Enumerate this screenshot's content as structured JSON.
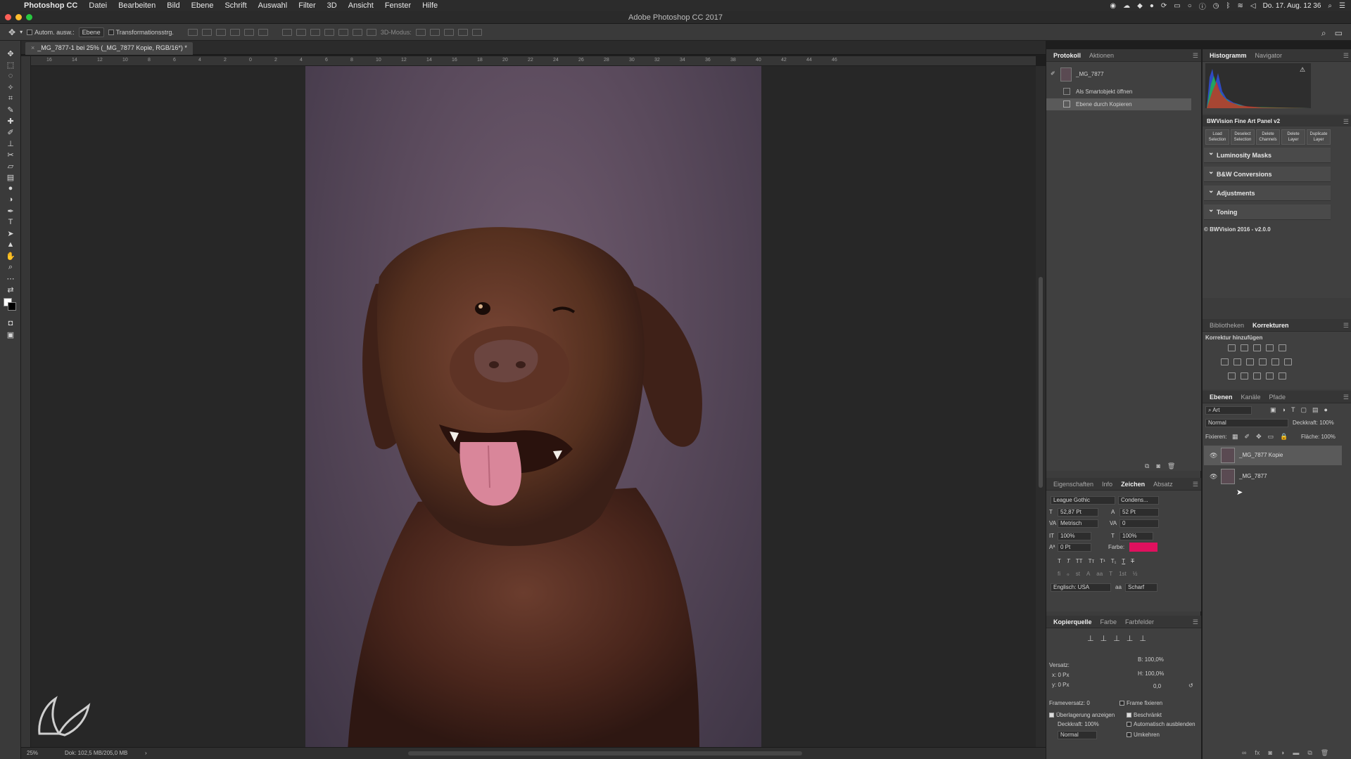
{
  "menubar": {
    "app": "Photoshop CC",
    "items": [
      "Datei",
      "Bearbeiten",
      "Bild",
      "Ebene",
      "Schrift",
      "Auswahl",
      "Filter",
      "3D",
      "Ansicht",
      "Fenster",
      "Hilfe"
    ],
    "clock": "Do. 17. Aug.  12 36"
  },
  "window": {
    "title": "Adobe Photoshop CC 2017"
  },
  "options": {
    "auto_select": "Autom. ausw.:",
    "target": "Ebene",
    "transform": "Transformationsstrg.",
    "mode3d": "3D-Modus:"
  },
  "document": {
    "tab": "_MG_7877-1 bei 25% (_MG_7877 Kopie, RGB/16*) *",
    "ruler_labels": [
      "16",
      "14",
      "12",
      "10",
      "8",
      "6",
      "4",
      "2",
      "0",
      "2",
      "4",
      "6",
      "8",
      "10",
      "12",
      "14",
      "16",
      "18",
      "20",
      "22",
      "24",
      "26",
      "28",
      "30",
      "32",
      "34",
      "36",
      "38",
      "40",
      "42",
      "44",
      "46"
    ],
    "zoom": "25%",
    "doc_size": "Dok: 102,5 MB/205,0 MB"
  },
  "history": {
    "tabs": [
      "Protokoll",
      "Aktionen"
    ],
    "snapshot": "_MG_7877",
    "steps": [
      "Als Smartobjekt öffnen",
      "Ebene durch Kopieren"
    ]
  },
  "character": {
    "tabs": [
      "Eigenschaften",
      "Info",
      "Zeichen",
      "Absatz"
    ],
    "font": "League Gothic",
    "style": "Condens...",
    "size": "52,87 Pt",
    "leading": "52 Pt",
    "kerning": "Metrisch",
    "tracking": "0",
    "vscale": "100%",
    "hscale": "100%",
    "baseline": "0 Pt",
    "color_label": "Farbe:",
    "color": "#e0105e",
    "language": "Englisch: USA",
    "antialias": "Scharf"
  },
  "clone_source": {
    "tabs": [
      "Kopierquelle",
      "Farbe",
      "Farbfelder"
    ],
    "offset_label": "Versatz:",
    "x": "x: 0 Px",
    "y": "y: 0 Px",
    "w": "B: 100,0%",
    "h": "H: 100,0%",
    "angle": "0,0",
    "frame_offset_label": "Frameversatz: 0",
    "lock_frame": "Frame fixieren",
    "show_overlay": "Überlagerung anzeigen",
    "clipped": "Beschränkt",
    "opacity": "Deckkraft: 100%",
    "auto_hide": "Automatisch ausblenden",
    "mode": "Normal",
    "invert": "Umkehren"
  },
  "histogram": {
    "tabs": [
      "Histogramm",
      "Navigator"
    ]
  },
  "bwvision": {
    "title": "BWVision Fine Art Panel v2",
    "buttons": [
      "Load Selection",
      "Deselect Selection",
      "Delete Channels",
      "Delete Layer",
      "Duplicate Layer"
    ],
    "sections": [
      "Luminosity Masks",
      "B&W Conversions",
      "Adjustments",
      "Toning"
    ],
    "footer": "© BWVision 2016 - v2.0.0"
  },
  "corrections": {
    "tabs": [
      "Bibliotheken",
      "Korrekturen"
    ],
    "add_label": "Korrektur hinzufügen"
  },
  "layers": {
    "tabs": [
      "Ebenen",
      "Kanäle",
      "Pfade"
    ],
    "filter": "Art",
    "blend": "Normal",
    "opacity": "Deckkraft: 100%",
    "lock_label": "Fixieren:",
    "fill": "Fläche: 100%",
    "items": [
      {
        "name": "_MG_7877 Kopie",
        "selected": true
      },
      {
        "name": "_MG_7877",
        "selected": false
      }
    ]
  }
}
